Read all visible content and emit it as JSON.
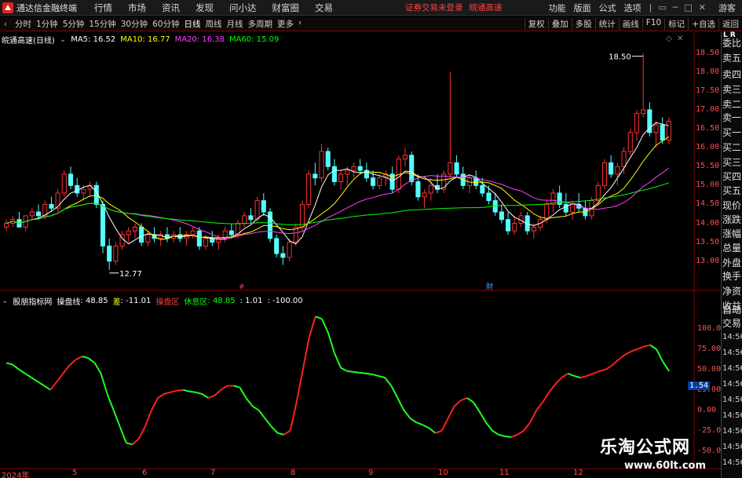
{
  "app": {
    "title": "通达信金融终端",
    "menu": [
      "行情",
      "市场",
      "资讯",
      "发现",
      "问小达",
      "财富圈",
      "交易"
    ],
    "notice": "证券交易未登录",
    "notice2": "皖通高速",
    "right_menu": [
      "功能",
      "版面",
      "公式",
      "选项"
    ],
    "guest": "游客"
  },
  "toolbar": {
    "periods": [
      "分时",
      "1分钟",
      "5分钟",
      "15分钟",
      "30分钟",
      "60分钟",
      "日线",
      "周线",
      "月线",
      "多周期",
      "更多"
    ],
    "active": "日线",
    "right_buttons": [
      "复权",
      "叠加",
      "多股",
      "统计",
      "画线",
      "F10",
      "标记",
      "+自选",
      "返回"
    ]
  },
  "chart": {
    "stock": "皖通高速(日线)",
    "ma5": "MA5: 16.52",
    "ma10": "MA10: 16.77",
    "ma20": "MA20: 16.38",
    "ma60": "MA60: 15.09",
    "high_label": "18.50",
    "low_label": "12.77",
    "marker_red": "#",
    "marker_blue": "财",
    "price_ticks": [
      "18.50",
      "18.00",
      "17.50",
      "17.00",
      "16.50",
      "16.00",
      "15.50",
      "15.00",
      "14.50",
      "14.00",
      "13.50",
      "13.00"
    ],
    "colors": {
      "up": "#ff3030",
      "down": "#54ffff",
      "ma5": "#ffffff",
      "ma10": "#ffff00",
      "ma20": "#ff40ff",
      "ma60": "#00ff00"
    }
  },
  "indicator": {
    "name": "股朋指标网",
    "line_label": "操盘线",
    "line_value": "48.85",
    "diff_label": "差",
    "diff_value": "-11.01",
    "zone1": "操盘区",
    "zone2": "休息区",
    "zone2_value": "48.85",
    "v1": "1.01",
    "v2": "-100.00",
    "ticks": [
      "100.00",
      "75.00",
      "50.00",
      "25.00",
      "0.00",
      "-25.00",
      "-50.00"
    ],
    "current_value": "1.54"
  },
  "dates": [
    "2024年",
    "5",
    "6",
    "7",
    "8",
    "9",
    "10",
    "11",
    "12"
  ],
  "side_panel": {
    "items": [
      "委比",
      "卖五",
      "卖四",
      "卖三",
      "卖二",
      "卖一",
      "买一",
      "买二",
      "买三",
      "买四",
      "买五",
      "现价",
      "涨跌",
      "涨幅",
      "总量",
      "外盘",
      "换手",
      "净资",
      "收益"
    ],
    "tabs": [
      "自动",
      "交易"
    ],
    "times": [
      "14:56",
      "14:56",
      "14:56",
      "14:56",
      "14:56",
      "14:56",
      "14:56",
      "14:56",
      "14:56"
    ],
    "corner": "L R"
  },
  "watermark": {
    "cn": "乐淘公式网",
    "url": "www.60lt.com"
  },
  "chart_data": {
    "type": "candlestick",
    "ylim": [
      12.6,
      18.7
    ],
    "candles": [
      [
        13.9,
        14.1,
        13.8,
        14.0
      ],
      [
        14.0,
        14.2,
        13.9,
        14.1
      ],
      [
        14.1,
        14.3,
        14.0,
        13.9
      ],
      [
        13.9,
        14.2,
        13.8,
        14.2
      ],
      [
        14.2,
        14.4,
        14.1,
        14.3
      ],
      [
        14.3,
        14.5,
        14.1,
        14.2
      ],
      [
        14.2,
        14.6,
        14.1,
        14.5
      ],
      [
        14.5,
        14.7,
        14.3,
        14.4
      ],
      [
        14.4,
        14.9,
        14.3,
        14.8
      ],
      [
        14.8,
        15.4,
        14.7,
        15.3
      ],
      [
        15.3,
        15.5,
        14.9,
        15.0
      ],
      [
        15.0,
        15.2,
        14.7,
        14.8
      ],
      [
        14.8,
        15.0,
        14.6,
        14.9
      ],
      [
        14.9,
        15.1,
        14.7,
        15.0
      ],
      [
        15.0,
        15.1,
        14.4,
        14.5
      ],
      [
        14.5,
        14.6,
        13.2,
        13.4
      ],
      [
        13.4,
        13.6,
        12.77,
        13.0
      ],
      [
        13.0,
        13.5,
        12.9,
        13.4
      ],
      [
        13.4,
        13.8,
        13.3,
        13.7
      ],
      [
        13.7,
        13.9,
        13.5,
        13.8
      ],
      [
        13.8,
        14.0,
        13.6,
        13.9
      ],
      [
        13.9,
        14.0,
        13.4,
        13.5
      ],
      [
        13.5,
        13.8,
        13.4,
        13.7
      ],
      [
        13.7,
        13.9,
        13.5,
        13.6
      ],
      [
        13.6,
        13.8,
        13.4,
        13.7
      ],
      [
        13.7,
        13.9,
        13.5,
        13.6
      ],
      [
        13.6,
        13.8,
        13.5,
        13.7
      ],
      [
        13.7,
        13.9,
        13.5,
        13.6
      ],
      [
        13.6,
        13.8,
        13.4,
        13.7
      ],
      [
        13.7,
        13.9,
        13.6,
        13.8
      ],
      [
        13.8,
        13.9,
        13.3,
        13.4
      ],
      [
        13.4,
        13.7,
        13.3,
        13.6
      ],
      [
        13.6,
        13.8,
        13.4,
        13.5
      ],
      [
        13.5,
        13.7,
        13.3,
        13.6
      ],
      [
        13.6,
        13.9,
        13.5,
        13.8
      ],
      [
        13.8,
        14.0,
        13.6,
        13.7
      ],
      [
        13.7,
        14.1,
        13.6,
        14.0
      ],
      [
        14.0,
        14.3,
        13.9,
        14.2
      ],
      [
        14.2,
        14.4,
        14.0,
        14.1
      ],
      [
        14.1,
        14.7,
        14.0,
        14.6
      ],
      [
        14.6,
        14.8,
        14.2,
        14.3
      ],
      [
        14.3,
        14.4,
        13.5,
        13.6
      ],
      [
        13.6,
        13.7,
        13.1,
        13.2
      ],
      [
        13.2,
        13.4,
        12.9,
        13.1
      ],
      [
        13.1,
        13.6,
        13.0,
        13.5
      ],
      [
        13.5,
        14.0,
        13.4,
        13.9
      ],
      [
        13.9,
        14.6,
        13.8,
        14.5
      ],
      [
        14.5,
        15.4,
        14.4,
        15.3
      ],
      [
        15.3,
        15.6,
        15.0,
        15.2
      ],
      [
        15.2,
        16.1,
        15.1,
        15.9
      ],
      [
        15.9,
        16.0,
        15.4,
        15.5
      ],
      [
        15.5,
        15.7,
        15.0,
        15.1
      ],
      [
        15.1,
        15.4,
        14.9,
        15.3
      ],
      [
        15.3,
        15.5,
        15.0,
        15.4
      ],
      [
        15.4,
        15.6,
        15.2,
        15.5
      ],
      [
        15.5,
        15.7,
        15.3,
        15.4
      ],
      [
        15.4,
        15.6,
        15.1,
        15.2
      ],
      [
        15.2,
        15.4,
        14.9,
        15.0
      ],
      [
        15.0,
        15.3,
        14.9,
        15.2
      ],
      [
        15.2,
        15.4,
        15.0,
        15.3
      ],
      [
        15.3,
        15.5,
        14.8,
        14.9
      ],
      [
        14.9,
        15.8,
        14.8,
        15.7
      ],
      [
        15.7,
        16.0,
        15.5,
        15.8
      ],
      [
        15.8,
        15.9,
        15.0,
        15.1
      ],
      [
        15.1,
        15.3,
        14.6,
        14.7
      ],
      [
        14.7,
        14.9,
        14.4,
        14.8
      ],
      [
        14.8,
        15.2,
        14.6,
        15.0
      ],
      [
        15.0,
        15.3,
        14.8,
        14.9
      ],
      [
        14.9,
        15.4,
        14.8,
        15.3
      ],
      [
        15.3,
        18.0,
        15.2,
        15.6
      ],
      [
        15.6,
        15.8,
        15.2,
        15.3
      ],
      [
        15.3,
        15.5,
        14.9,
        15.0
      ],
      [
        15.0,
        15.3,
        14.8,
        15.2
      ],
      [
        15.2,
        15.4,
        14.9,
        15.0
      ],
      [
        15.0,
        15.2,
        14.7,
        14.8
      ],
      [
        14.8,
        15.0,
        14.5,
        14.6
      ],
      [
        14.6,
        14.8,
        14.2,
        14.3
      ],
      [
        14.3,
        14.5,
        14.0,
        14.1
      ],
      [
        14.1,
        14.3,
        13.7,
        13.8
      ],
      [
        13.8,
        14.2,
        13.7,
        14.0
      ],
      [
        14.0,
        14.3,
        13.9,
        14.2
      ],
      [
        14.2,
        14.3,
        13.7,
        13.8
      ],
      [
        13.8,
        14.0,
        13.6,
        13.9
      ],
      [
        13.9,
        14.2,
        13.8,
        14.1
      ],
      [
        14.1,
        14.6,
        14.0,
        14.5
      ],
      [
        14.5,
        14.9,
        14.3,
        14.8
      ],
      [
        14.8,
        15.0,
        14.4,
        14.5
      ],
      [
        14.5,
        14.8,
        14.2,
        14.3
      ],
      [
        14.3,
        14.6,
        14.1,
        14.5
      ],
      [
        14.5,
        14.8,
        14.3,
        14.4
      ],
      [
        14.4,
        14.6,
        14.1,
        14.2
      ],
      [
        14.2,
        14.7,
        14.1,
        14.6
      ],
      [
        14.6,
        15.1,
        14.5,
        15.0
      ],
      [
        15.0,
        15.7,
        14.9,
        15.6
      ],
      [
        15.6,
        15.8,
        15.2,
        15.3
      ],
      [
        15.3,
        15.6,
        15.0,
        15.5
      ],
      [
        15.5,
        16.0,
        15.3,
        15.9
      ],
      [
        15.9,
        16.5,
        15.8,
        16.4
      ],
      [
        16.4,
        17.0,
        16.2,
        16.9
      ],
      [
        16.9,
        18.5,
        16.8,
        17.0
      ],
      [
        17.0,
        17.2,
        16.3,
        16.4
      ],
      [
        16.4,
        16.7,
        16.0,
        16.6
      ],
      [
        16.6,
        16.8,
        16.1,
        16.2
      ],
      [
        16.2,
        16.8,
        16.1,
        16.7
      ]
    ],
    "indicator_series": [
      58,
      56,
      50,
      45,
      40,
      35,
      30,
      25,
      35,
      45,
      55,
      62,
      66,
      64,
      58,
      45,
      20,
      0,
      -20,
      -40,
      -42,
      -35,
      -20,
      0,
      15,
      20,
      22,
      24,
      25,
      23,
      22,
      20,
      15,
      18,
      25,
      30,
      30,
      28,
      15,
      5,
      0,
      -10,
      -20,
      -28,
      -30,
      -25,
      10,
      50,
      90,
      115,
      112,
      95,
      70,
      52,
      48,
      47,
      46,
      45,
      44,
      42,
      40,
      30,
      15,
      0,
      -10,
      -15,
      -18,
      -22,
      -28,
      -25,
      -10,
      5,
      12,
      15,
      10,
      -2,
      -15,
      -25,
      -30,
      -32,
      -33,
      -30,
      -25,
      -15,
      0,
      10,
      22,
      32,
      40,
      45,
      42,
      40,
      42,
      45,
      48,
      50,
      55,
      62,
      68,
      72,
      75,
      78,
      80,
      75,
      60,
      48
    ]
  }
}
